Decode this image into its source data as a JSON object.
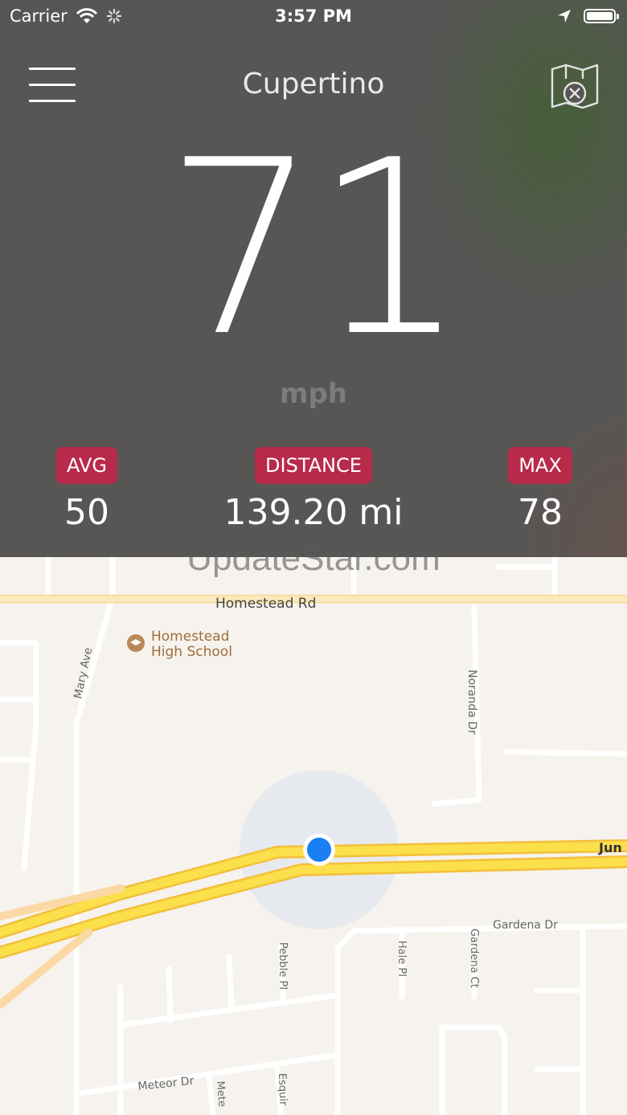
{
  "status_bar": {
    "carrier": "Carrier",
    "time": "3:57 PM"
  },
  "header": {
    "title": "Cupertino",
    "menu_icon": "hamburger-icon",
    "map_toggle_icon": "map-close-icon"
  },
  "speed": {
    "value": "71",
    "unit": "mph"
  },
  "stats": {
    "avg": {
      "label": "AVG",
      "value": "50"
    },
    "distance": {
      "label": "DISTANCE",
      "value": "139.20 mi"
    },
    "max": {
      "label": "MAX",
      "value": "78"
    }
  },
  "watermark": "UpdateStar.com",
  "map": {
    "streets": {
      "homestead": "Homestead Rd",
      "mary": "Mary Ave",
      "noranda": "Noranda Dr",
      "junipero": "Jun",
      "gardena_dr": "Gardena Dr",
      "gardena_ct": "Gardena Ct",
      "hale": "Hale Pl",
      "pebble": "Pebble Pl",
      "meteor": "Meteor Dr",
      "mete": "Mete",
      "esquire": "Esquir"
    },
    "poi": {
      "line1": "Homestead",
      "line2": "High School"
    }
  },
  "colors": {
    "panel": "#575655",
    "badge": "#b82a4a",
    "map_bg": "#f6f3ee",
    "highway": "#f9d94a",
    "location_dot": "#1a7ef5"
  }
}
